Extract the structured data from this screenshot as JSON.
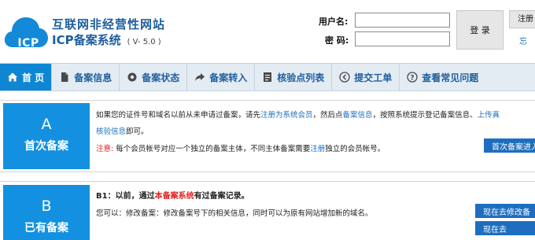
{
  "header": {
    "logo_text": "ICP",
    "title_line1": "互联网非经营性网站",
    "title_line2": "ICP备案系统",
    "version": "( V- 5.0 )"
  },
  "login": {
    "username_label": "用户名:",
    "username_value": "",
    "password_label": "密  码:",
    "password_value": "",
    "login_button": "登  录",
    "register_button": "注册",
    "forgot_link": "忘"
  },
  "nav": {
    "items": [
      {
        "label": "首 页",
        "icon": "home-icon",
        "active": true
      },
      {
        "label": "备案信息",
        "icon": "document-icon",
        "active": false
      },
      {
        "label": "备案状态",
        "icon": "gear-icon",
        "active": false
      },
      {
        "label": "备案转入",
        "icon": "share-arrow-icon",
        "active": false
      },
      {
        "label": "核验点列表",
        "icon": "list-icon",
        "active": false
      },
      {
        "label": "提交工单",
        "icon": "chevron-circle-icon",
        "active": false
      },
      {
        "label": "查看常见问题",
        "icon": "question-circle-icon",
        "active": false
      }
    ]
  },
  "card_a": {
    "letter": "A",
    "title": "首次备案",
    "line1_pre": "如果您的证件号和域名以前从未申请过备案，请先",
    "line1_link1": "注册为系统会员",
    "line1_mid": "，然后点",
    "line1_link2": "备案信息",
    "line1_post": "，按照系统提示登记备案信息、",
    "line1_link3": "上传真",
    "line2_link": "核验信息",
    "line2_post": "即可。",
    "note_label": "注意:",
    "note_pre": " 每个会员帐号对应一个独立的备案主体，不同主体备案需要",
    "note_link": "注册",
    "note_post": "独立的会员帐号。",
    "button": "首次备案进入"
  },
  "card_b": {
    "letter": "B",
    "title": "已有备案",
    "b1_pre": "B1：以前，通过",
    "b1_red": "本备案系统",
    "b1_post": "有过备案记录。",
    "line_pre": "您可以：修改备案：修改备案号下的相关信息，同时可以为原有网站增加新的域名。",
    "button1": "现在去修改备",
    "button2": "现在去"
  },
  "colors": {
    "brand_blue": "#1490e0",
    "nav_bg": "#e4ecf3",
    "link_blue": "#1a6fc0",
    "alert_red": "#e02020",
    "button_blue": "#1e6ebf"
  }
}
